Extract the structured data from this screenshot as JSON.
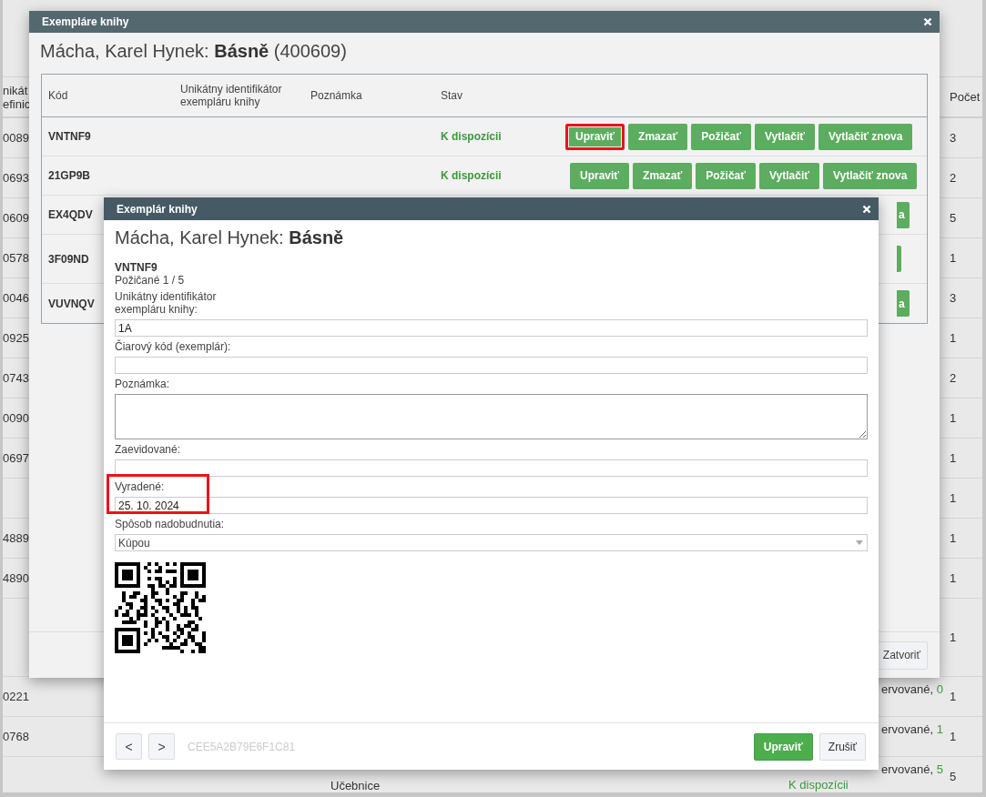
{
  "background_table": {
    "column_1_header": "nikát\nefinic",
    "count_header": "Počet",
    "rows": [
      {
        "column_1": "0089",
        "count": "3"
      },
      {
        "column_1": "0693",
        "count": "2"
      },
      {
        "column_1": "0609",
        "count": "5"
      },
      {
        "column_1": "0578",
        "count": "1"
      },
      {
        "column_1": "0046",
        "count": "3"
      },
      {
        "column_1": "0925",
        "count": "1"
      },
      {
        "column_1": "0743",
        "count": "2"
      },
      {
        "column_1": "0090",
        "count": "1"
      },
      {
        "column_1": "0697",
        "count": "1"
      },
      {
        "count": "1"
      },
      {
        "column_1": "4889",
        "count": "1"
      },
      {
        "column_1": "4890",
        "count": "1"
      },
      {
        "count": "1"
      },
      {
        "column_1": "0221",
        "count": "1",
        "status_start": "ervované, ",
        "status_count": "0"
      },
      {
        "column_1": "0768",
        "count": "1",
        "status_start": "ervované, ",
        "status_count": "1"
      },
      {
        "column_3": "Učebnice",
        "count": "5",
        "status_start": "ervované, ",
        "status_count": "5",
        "status_next": "K dispozícii"
      }
    ]
  },
  "copies_dialog": {
    "title": "Exempláre knihy",
    "heading": "Mácha, Karel Hynek: **Básně** (400609)",
    "columns": [
      "Kód",
      "Unikátny identifikátor exempláru knihy",
      "Poznámka",
      "Stav"
    ],
    "rows": [
      {
        "code": "VNTNF9",
        "status": "K dispozícii",
        "actions": [
          {
            "label": "Upraviť",
            "highlighted": true
          },
          {
            "label": "Zmazať",
            "highlighted": false
          },
          {
            "label": "Požičať",
            "highlighted": false
          },
          {
            "label": "Vytlačiť",
            "highlighted": false
          },
          {
            "label": "Vytlačiť znova",
            "highlighted": false
          }
        ]
      },
      {
        "code": "21GP9B",
        "status": "K dispozícii",
        "actions": [
          {
            "label": "Upraviť",
            "highlighted": false
          },
          {
            "label": "Zmazať",
            "highlighted": false
          },
          {
            "label": "Požičať",
            "highlighted": false
          },
          {
            "label": "Vytlačiť",
            "highlighted": false
          },
          {
            "label": "Vytlačiť znova",
            "highlighted": false
          }
        ]
      },
      {
        "code": "EX4QDV",
        "action_fragment": "a"
      },
      {
        "code": "3F09ND",
        "action_edge": true
      },
      {
        "code": "VUVNQV",
        "action_fragment": "a"
      }
    ],
    "close_button": "Zatvoriť"
  },
  "copy_dialog": {
    "title": "Exemplár knihy",
    "heading": "Mácha, Karel Hynek: **Básně**",
    "code": "VNTNF9",
    "loan_info": "Požičané 1 / 5",
    "fields": [
      {
        "kind": "text",
        "label": "Unikátny identifikátor\nexempláru knihy:",
        "value": "1A",
        "highlighted": false
      },
      {
        "kind": "text",
        "label": "Čiarový kód (exemplár):",
        "highlighted": false
      },
      {
        "kind": "textarea",
        "label": "Poznámka:",
        "highlighted": false
      },
      {
        "kind": "text",
        "label": "Zaevidované:",
        "highlighted": false
      },
      {
        "kind": "text",
        "label": "Vyradené:",
        "value": "25. 10. 2024",
        "highlighted": true
      },
      {
        "kind": "select",
        "label": "Spôsob nadobudnutia:",
        "value": "Kúpou",
        "highlighted": false
      }
    ],
    "prev_button": "<",
    "next_button": ">",
    "hash": "CEE5A2B79E6F1C81",
    "submit_button": "Upraviť",
    "cancel_button": "Zrušiť"
  }
}
